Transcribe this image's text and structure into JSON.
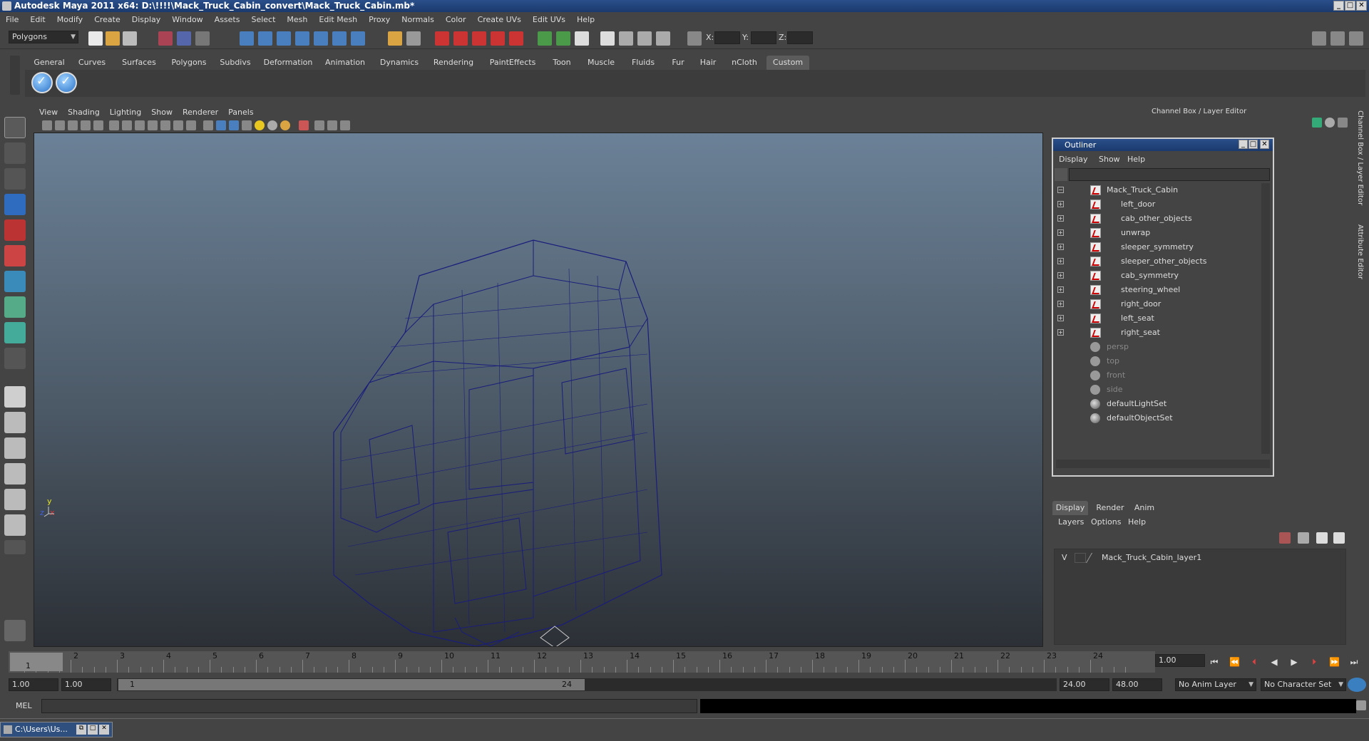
{
  "window": {
    "title": "Autodesk Maya 2011 x64: D:\\!!!!\\Mack_Truck_Cabin_convert\\Mack_Truck_Cabin.mb*"
  },
  "menu": [
    "File",
    "Edit",
    "Modify",
    "Create",
    "Display",
    "Window",
    "Assets",
    "Select",
    "Mesh",
    "Edit Mesh",
    "Proxy",
    "Normals",
    "Color",
    "Create UVs",
    "Edit UVs",
    "Help"
  ],
  "statusline": {
    "mode": "Polygons",
    "x_label": "X:",
    "y_label": "Y:",
    "z_label": "Z:"
  },
  "shelf_tabs": [
    "General",
    "Curves",
    "Surfaces",
    "Polygons",
    "Subdivs",
    "Deformation",
    "Animation",
    "Dynamics",
    "Rendering",
    "PaintEffects",
    "Toon",
    "Muscle",
    "Fluids",
    "Fur",
    "Hair",
    "nCloth",
    "Custom"
  ],
  "shelf_active": "Custom",
  "viewport": {
    "menu": [
      "View",
      "Shading",
      "Lighting",
      "Show",
      "Renderer",
      "Panels"
    ],
    "axis_y": "y",
    "axis_x": "x",
    "axis_z": "z",
    "wire_color": "#1a1d7a"
  },
  "channel_box": {
    "title": "Channel Box / Layer Editor",
    "side_tab_1": "Channel Box / Layer Editor",
    "side_tab_2": "Attribute Editor"
  },
  "outliner": {
    "title": "Outliner",
    "menu": [
      "Display",
      "Show",
      "Help"
    ],
    "root": "Mack_Truck_Cabin",
    "children": [
      "left_door",
      "cab_other_objects",
      "unwrap",
      "sleeper_symmetry",
      "sleeper_other_objects",
      "cab_symmetry",
      "steering_wheel",
      "right_door",
      "left_seat",
      "right_seat"
    ],
    "cameras": [
      "persp",
      "top",
      "front",
      "side"
    ],
    "sets": [
      "defaultLightSet",
      "defaultObjectSet"
    ]
  },
  "layer_editor": {
    "tabs": [
      "Display",
      "Render",
      "Anim"
    ],
    "menu": [
      "Layers",
      "Options",
      "Help"
    ],
    "layer_visible": "V",
    "layer_name": "Mack_Truck_Cabin_layer1"
  },
  "timeline": {
    "ticks": [
      1,
      2,
      3,
      4,
      5,
      6,
      7,
      8,
      9,
      10,
      11,
      12,
      13,
      14,
      15,
      16,
      17,
      18,
      19,
      20,
      21,
      22,
      23,
      24
    ],
    "current": "1",
    "current_time": "1.00"
  },
  "range": {
    "start": "1.00",
    "playback_start": "1.00",
    "slider_start": "1",
    "slider_end": "24",
    "playback_end": "24.00",
    "end": "48.00",
    "anim_layer": "No Anim Layer",
    "character_set": "No Character Set"
  },
  "command": {
    "label": "MEL"
  },
  "taskbar": {
    "item": "C:\\Users\\Us..."
  }
}
